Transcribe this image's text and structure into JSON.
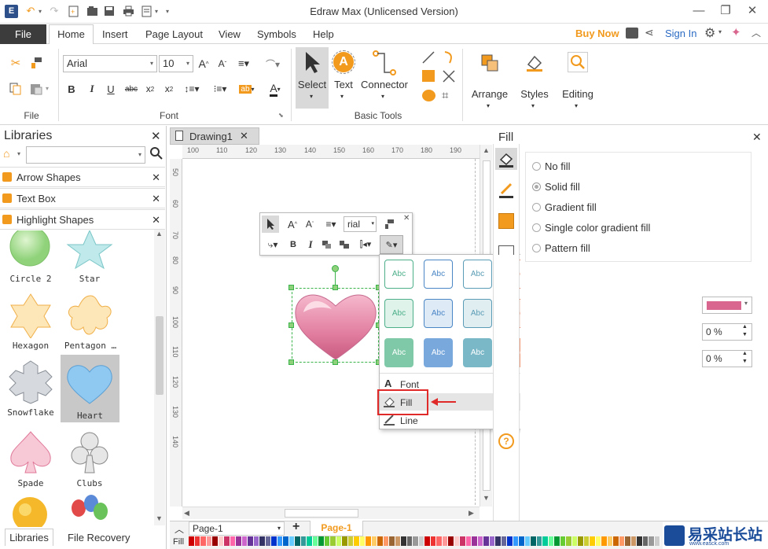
{
  "app": {
    "title": "Edraw Max (Unlicensed Version)"
  },
  "menu": {
    "file": "File",
    "tabs": [
      "Home",
      "Insert",
      "Page Layout",
      "View",
      "Symbols",
      "Help"
    ],
    "buy_now": "Buy Now",
    "sign_in": "Sign In"
  },
  "ribbon": {
    "file_group": "File",
    "font_group": "Font",
    "font_name": "Arial",
    "font_size": "10",
    "basic_tools_group": "Basic Tools",
    "select": "Select",
    "text": "Text",
    "connector": "Connector",
    "arrange": "Arrange",
    "styles": "Styles",
    "editing": "Editing"
  },
  "libraries": {
    "title": "Libraries",
    "groups": [
      "Arrow Shapes",
      "Text Box",
      "Highlight Shapes"
    ],
    "shapes": [
      "Circle 2",
      "Star",
      "Hexagon",
      "Pentagon …",
      "Snowflake",
      "Heart",
      "Spade",
      "Clubs"
    ],
    "bottom_tabs": [
      "Libraries",
      "File Recovery"
    ]
  },
  "document": {
    "tab": "Drawing1",
    "ruler_top": [
      "100",
      "110",
      "120",
      "130",
      "140",
      "150",
      "160",
      "170",
      "180",
      "190"
    ],
    "ruler_left": [
      "50",
      "60",
      "70",
      "80",
      "90",
      "100",
      "110",
      "120",
      "130",
      "140"
    ]
  },
  "minitoolbar": {
    "font_field": "rial"
  },
  "style_popup": {
    "swatch_label": "Abc",
    "row_colors": [
      [
        "#4caf8a",
        "#4a86c5",
        "#5a9cb5",
        "#e07a5a",
        "#e8a050",
        "#d06a8a",
        "#6a7a90"
      ],
      [
        "#dff3ea",
        "#dfeaf7",
        "#e0eef2",
        "#fbe5dc",
        "#fcecd8",
        "#f8e2ea",
        "#e4e8ee"
      ],
      [
        "#7fc9a8",
        "#79a8dd",
        "#7ab8c8",
        "#f09a78",
        "#f7bb70",
        "#e58fa8",
        "#8a96aa"
      ]
    ],
    "menu_items": [
      "Font",
      "Fill",
      "Line"
    ]
  },
  "fill_panel": {
    "title": "Fill",
    "options": [
      "No fill",
      "Solid fill",
      "Gradient fill",
      "Single color gradient fill",
      "Pattern fill"
    ],
    "selected_option": "Solid fill",
    "fill_color": "#d9668e",
    "transparency": "0 %",
    "brightness": "0 %"
  },
  "bottom": {
    "page_select": "Page-1",
    "page_tab": "Page-1",
    "fill_label": "Fill"
  },
  "watermark": {
    "text": "易采站长站",
    "url": "www.easck.com"
  }
}
